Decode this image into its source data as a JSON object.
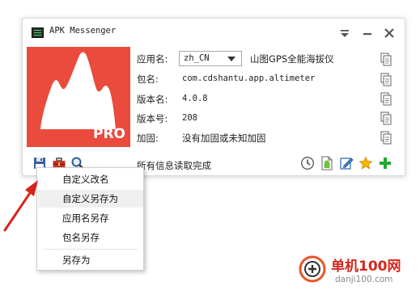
{
  "window": {
    "title": "APK Messenger",
    "pin_icon": "pin-dropdown-icon",
    "minimize_icon": "minimize-icon",
    "close_icon": "close-icon"
  },
  "logo": {
    "badge_text": "PRO",
    "icon": "mountain-logo-icon",
    "color": "#ea4b3d"
  },
  "fields": {
    "app_name_label": "应用名:",
    "language_selected": "zh_CN",
    "app_name_value": "山图GPS全能海拔仪",
    "package_label": "包名:",
    "package_value": "com.cdshantu.app.altimeter",
    "version_name_label": "版本名:",
    "version_name_value": "4.0.8",
    "version_code_label": "版本号:",
    "version_code_value": "208",
    "reinforce_label": "加固:",
    "reinforce_value": "没有加固或未知加固"
  },
  "status": "所有信息读取完成",
  "toolbar_left": [
    "save-icon",
    "toolbox-icon",
    "search-icon"
  ],
  "toolbar_right": [
    "clock-icon",
    "android-file-icon",
    "edit-icon",
    "star-icon",
    "add-icon"
  ],
  "menu": {
    "items": [
      "自定义改名",
      "自定义另存为",
      "应用名另存",
      "包名另存",
      "另存为"
    ],
    "highlighted_index": 1
  },
  "watermark": {
    "name": "单机100网",
    "url": "danji100.com"
  },
  "colors": {
    "accent_red": "#d6261c",
    "add_green": "#22a832",
    "star_yellow": "#f5b50a"
  }
}
